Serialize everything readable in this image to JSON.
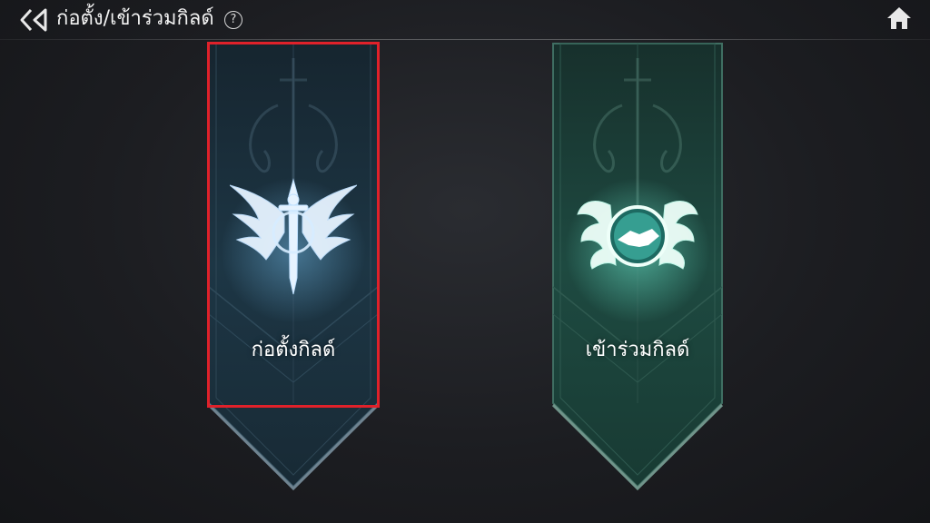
{
  "header": {
    "title": "ก่อตั้ง/เข้าร่วมกิลด์",
    "help_symbol": "?",
    "back_icon": "double-chevron-left-icon",
    "home_icon": "home-icon"
  },
  "banners": [
    {
      "label": "ก่อตั้งกิลด์",
      "emblem": "winged-sword-icon",
      "color": "#1d3a4a",
      "selected": true
    },
    {
      "label": "เข้าร่วมกิลด์",
      "emblem": "handshake-wings-icon",
      "color": "#1f4a40",
      "selected": false
    }
  ],
  "colors": {
    "selection": "#e0212a",
    "create_glow": "#cfe8ff",
    "join_glow": "#c8fff0"
  }
}
